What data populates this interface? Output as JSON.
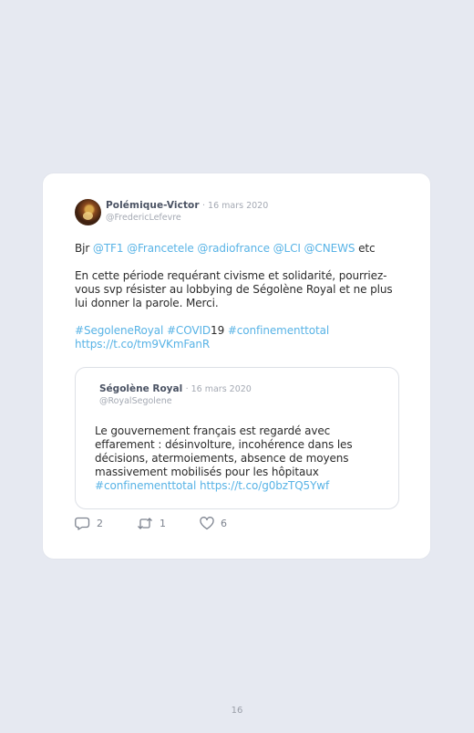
{
  "tweet": {
    "author_name": "Polémique-Victor",
    "date": "· 16 mars 2020",
    "handle": "@FredericLefevre",
    "line1": {
      "prefix": "Bjr ",
      "mentions": "@TF1 @Francetele @radiofrance @LCI @CNEWS",
      "suffix": " etc"
    },
    "paragraph": "En cette période requérant civisme et solidarité, pourriez-vous svp résister au lobbying de Ségolène Royal et ne plus lui donner la parole. Merci.",
    "hashtags": {
      "tag1": "#SegoleneRoyal #COVID",
      "num": "19",
      "tag2": " #confinementtotal"
    },
    "link": "https://t.co/tm9VKmFanR"
  },
  "quoted": {
    "author_name": "Ségolène Royal",
    "date": "· 16 mars 2020",
    "handle": "@RoyalSegolene",
    "text": "Le gouvernement français est regardé avec effarement : désinvolture, incohérence dans les décisions, atermoiements, absence de moyens massivement mobilisés pour les hôpitaux",
    "tail": "#confinementtotal https://t.co/g0bzTQ5Ywf"
  },
  "actions": {
    "replies": "2",
    "retweets": "1",
    "likes": "6"
  },
  "page_number": "16"
}
